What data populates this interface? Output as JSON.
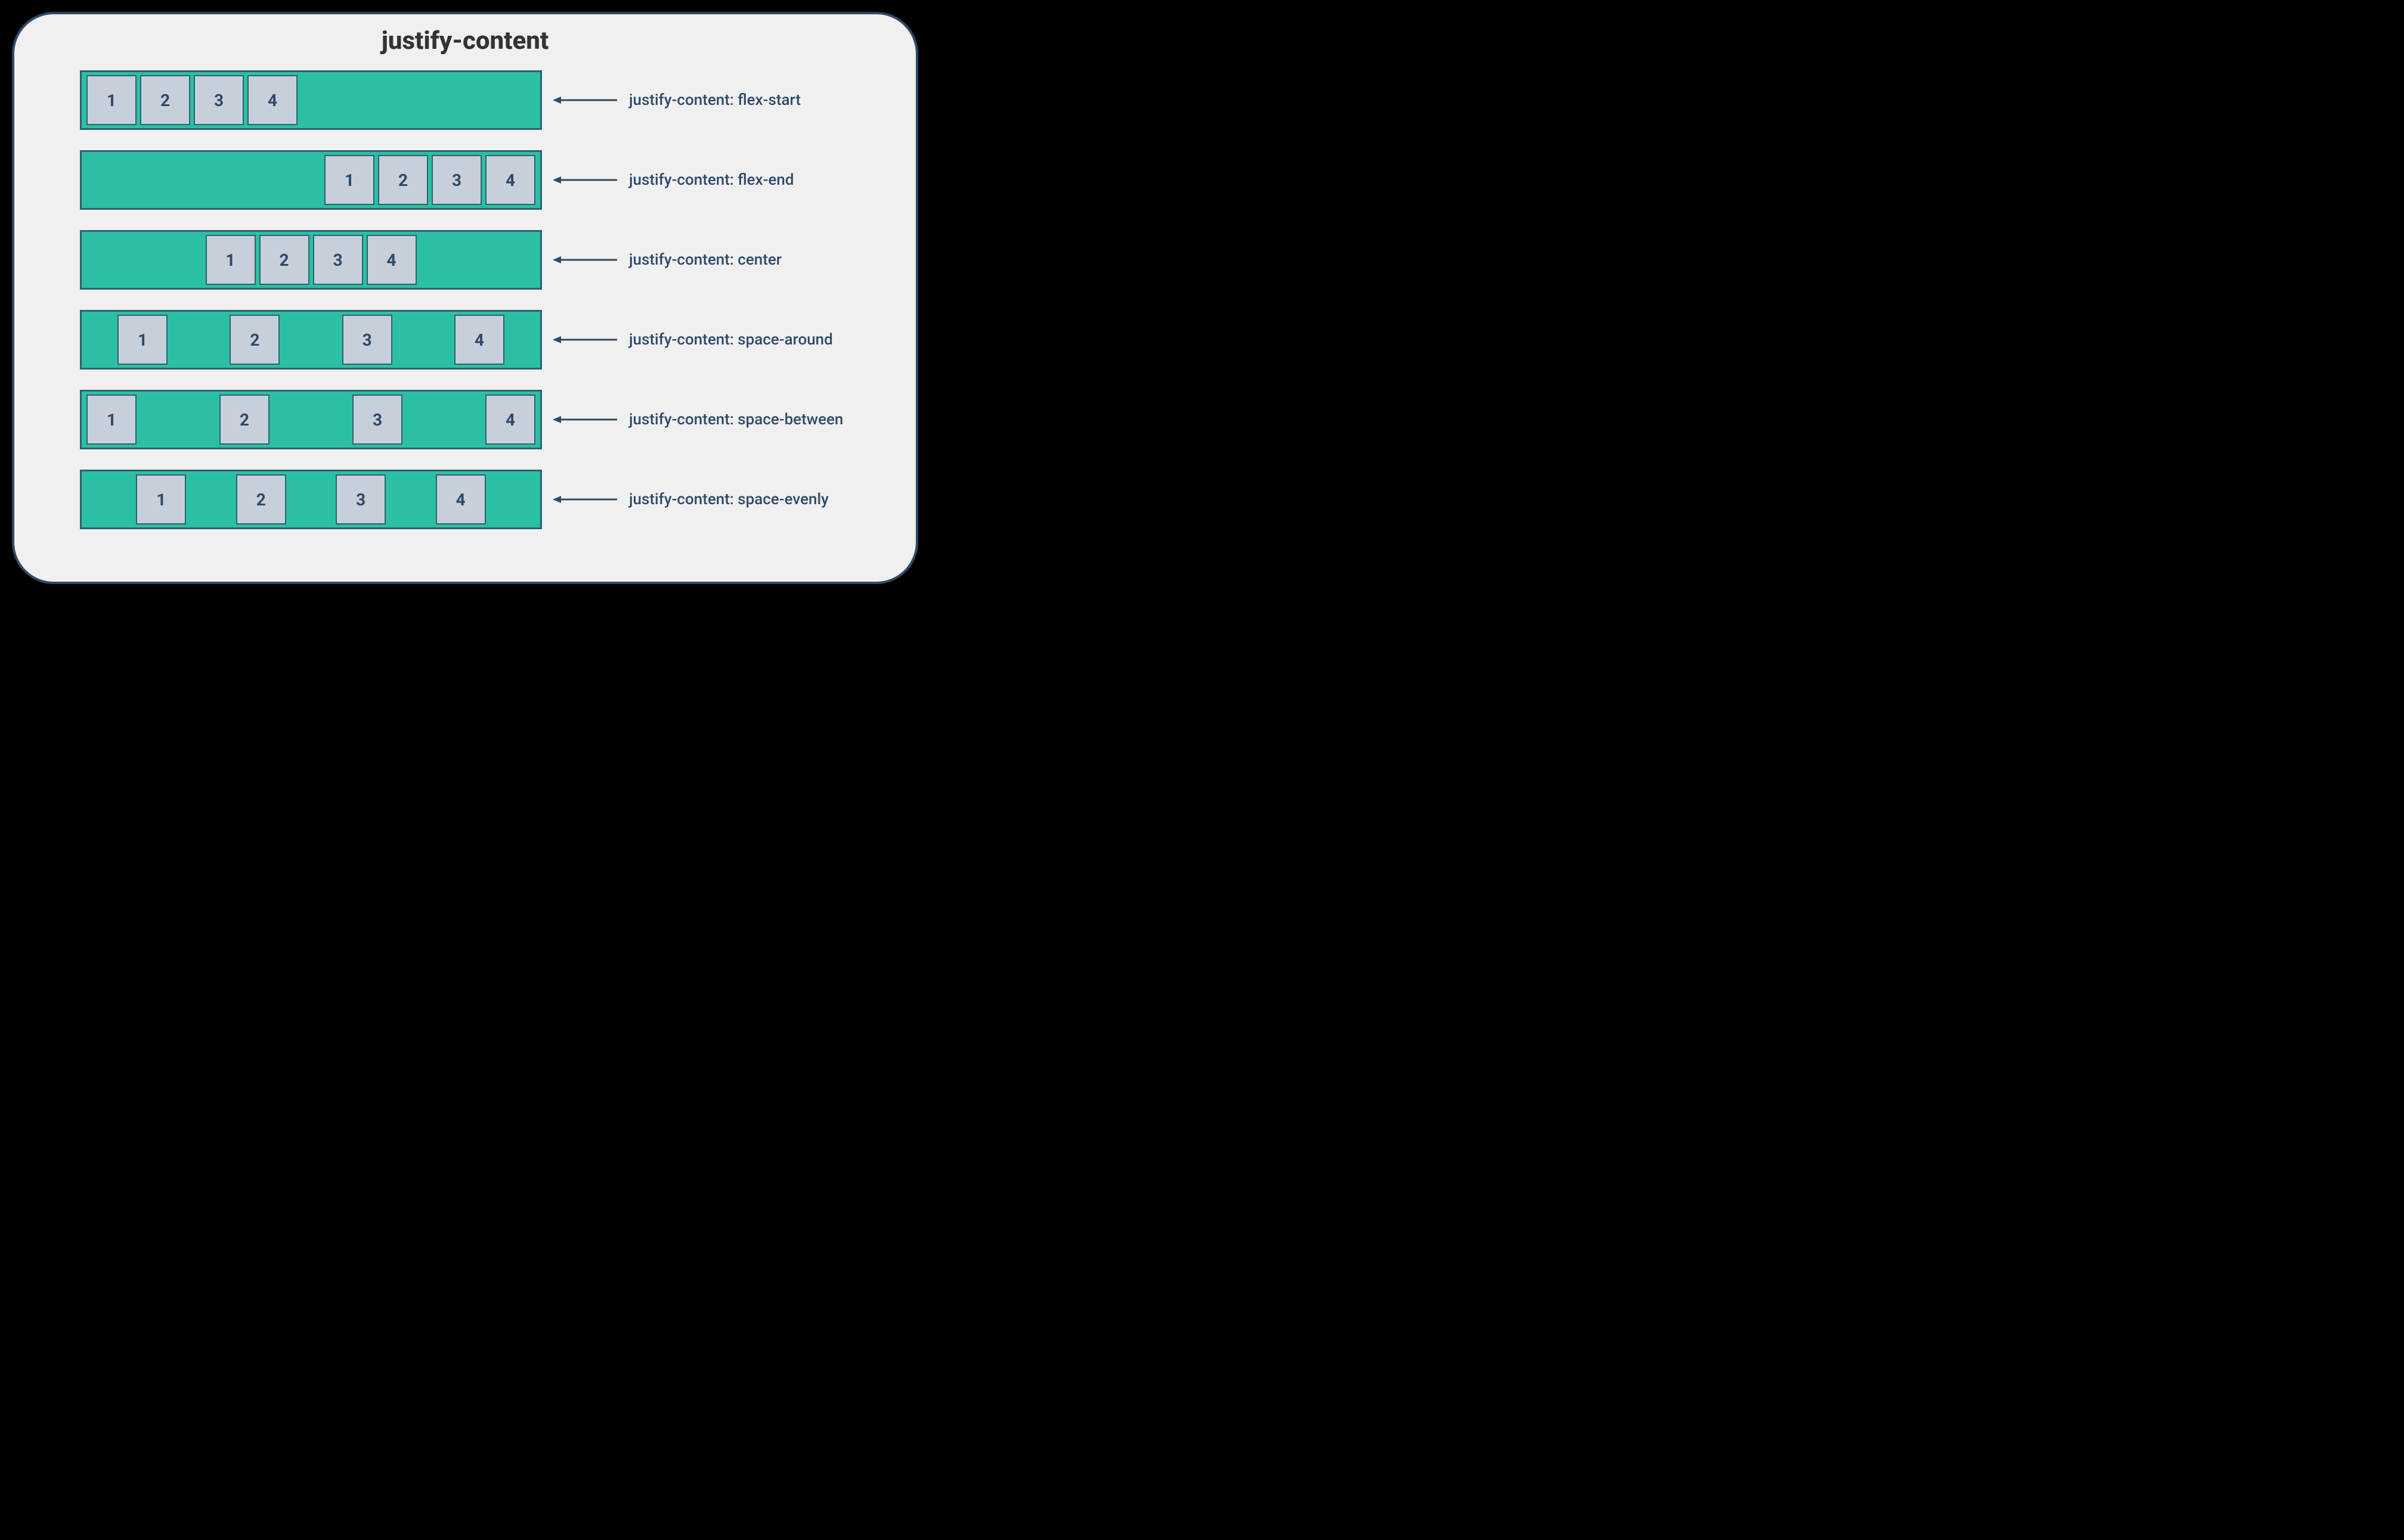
{
  "title": "justify-content",
  "items": [
    "1",
    "2",
    "3",
    "4"
  ],
  "rows": [
    {
      "justify": "flex-start",
      "label": "justify-content: flex-start"
    },
    {
      "justify": "flex-end",
      "label": "justify-content: flex-end"
    },
    {
      "justify": "center",
      "label": "justify-content: center"
    },
    {
      "justify": "space-around",
      "label": "justify-content: space-around"
    },
    {
      "justify": "space-between",
      "label": "justify-content: space-between"
    },
    {
      "justify": "space-evenly",
      "label": "justify-content: space-evenly"
    }
  ],
  "colors": {
    "container": "#2bc0a3",
    "box": "#c7cfdb",
    "border": "#2e6170",
    "text": "#2e4a69",
    "panelBorder": "#2e4a69",
    "panelBg": "#f0f0f0"
  }
}
